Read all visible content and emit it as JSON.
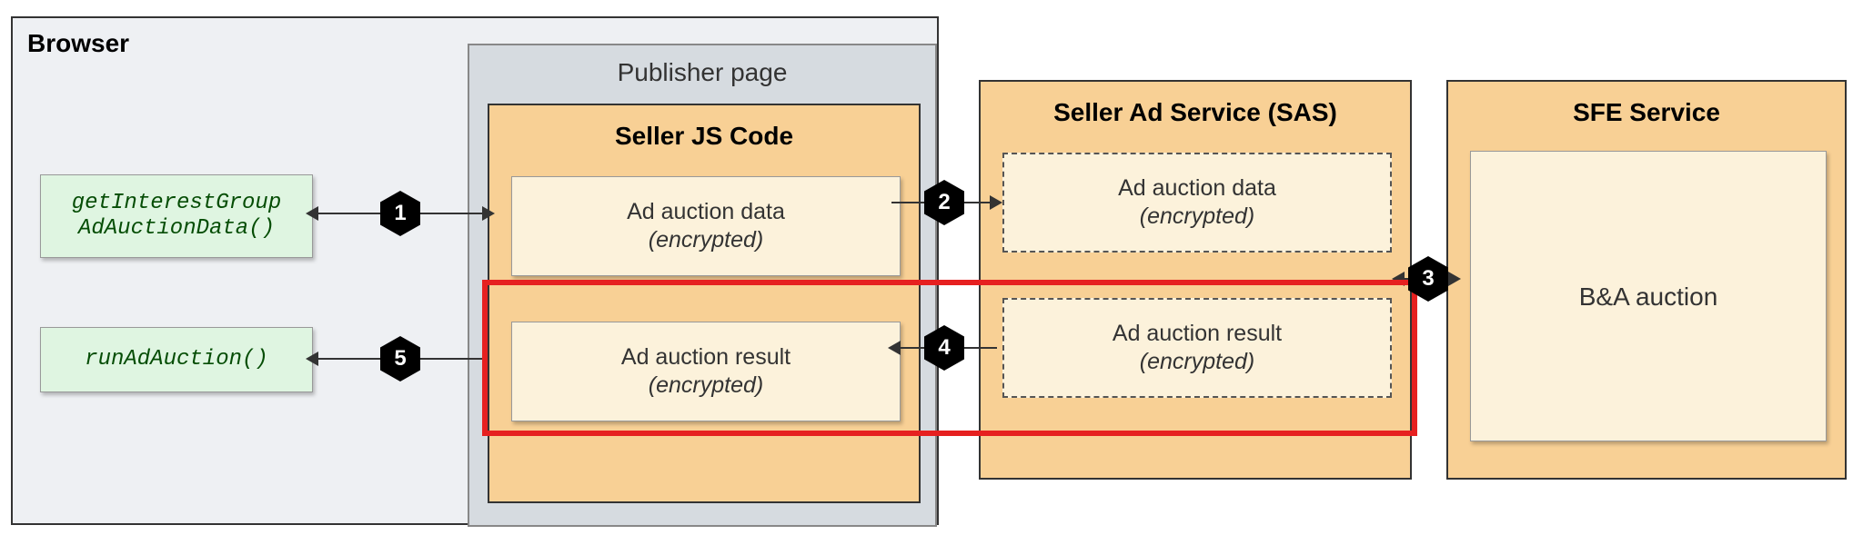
{
  "browser": {
    "label": "Browser",
    "api1_line1": "getInterestGroup",
    "api1_line2": "AdAuctionData()",
    "api2": "runAdAuction()"
  },
  "publisher": {
    "label": "Publisher page"
  },
  "seller": {
    "title": "Seller JS Code",
    "box1_line1": "Ad auction data",
    "box1_line2": "(encrypted)",
    "box2_line1": "Ad auction result",
    "box2_line2": "(encrypted)"
  },
  "sas": {
    "title": "Seller Ad Service (SAS)",
    "box1_line1": "Ad auction data",
    "box1_line2": "(encrypted)",
    "box2_line1": "Ad auction result",
    "box2_line2": "(encrypted)"
  },
  "sfe": {
    "title": "SFE Service",
    "inner": "B&A auction"
  },
  "steps": {
    "s1": "1",
    "s2": "2",
    "s3": "3",
    "s4": "4",
    "s5": "5"
  }
}
